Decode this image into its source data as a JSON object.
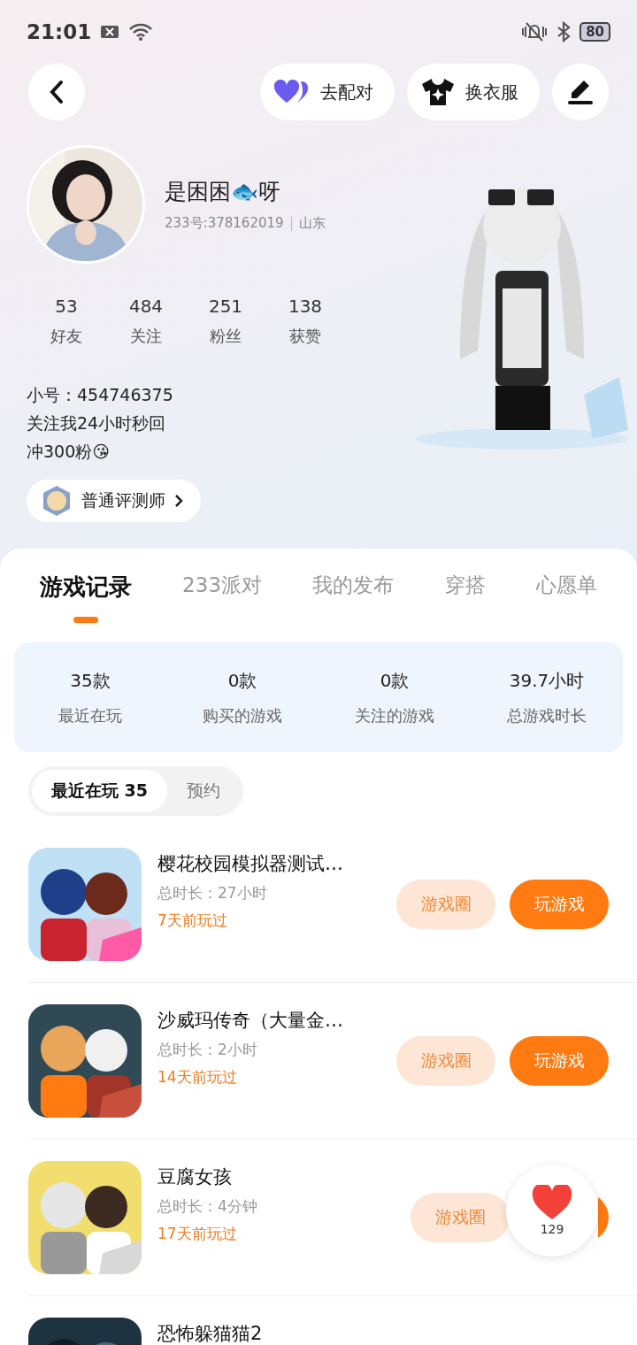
{
  "status_bar": {
    "time": "21:01",
    "battery": "80"
  },
  "top_bar": {
    "match_label": "去配对",
    "outfit_label": "换衣服"
  },
  "profile": {
    "name": "是困困🐟呀",
    "id_line": "233号:378162019",
    "location": "山东",
    "stats": [
      {
        "value": "53",
        "label": "好友"
      },
      {
        "value": "484",
        "label": "关注"
      },
      {
        "value": "251",
        "label": "粉丝"
      },
      {
        "value": "138",
        "label": "获赞"
      }
    ],
    "bio": [
      "小号：454746375",
      "关注我24小时秒回",
      "冲300粉😘"
    ],
    "badge": "普通评测师"
  },
  "tabs": [
    {
      "label": "游戏记录",
      "selected": true
    },
    {
      "label": "233派对",
      "selected": false
    },
    {
      "label": "我的发布",
      "selected": false
    },
    {
      "label": "穿搭",
      "selected": false
    },
    {
      "label": "心愿单",
      "selected": false
    }
  ],
  "summary": [
    {
      "value": "35款",
      "label": "最近在玩"
    },
    {
      "value": "0款",
      "label": "购买的游戏"
    },
    {
      "value": "0款",
      "label": "关注的游戏"
    },
    {
      "value": "39.7小时",
      "label": "总游戏时长"
    }
  ],
  "segments": [
    {
      "label": "最近在玩 35",
      "selected": true
    },
    {
      "label": "预约",
      "selected": false
    }
  ],
  "games": [
    {
      "name": "樱花校园模拟器测试…",
      "duration": "总时长：27小时",
      "last_played": "7天前玩过",
      "circle": "游戏圈",
      "play": "玩游戏"
    },
    {
      "name": "沙威玛传奇（大量金…",
      "duration": "总时长：2小时",
      "last_played": "14天前玩过",
      "circle": "游戏圈",
      "play": "玩游戏"
    },
    {
      "name": "豆腐女孩",
      "duration": "总时长：4分钟",
      "last_played": "17天前玩过",
      "circle": "游戏圈"
    },
    {
      "name": "恐怖躲猫猫2"
    }
  ],
  "like": {
    "count": "129"
  }
}
